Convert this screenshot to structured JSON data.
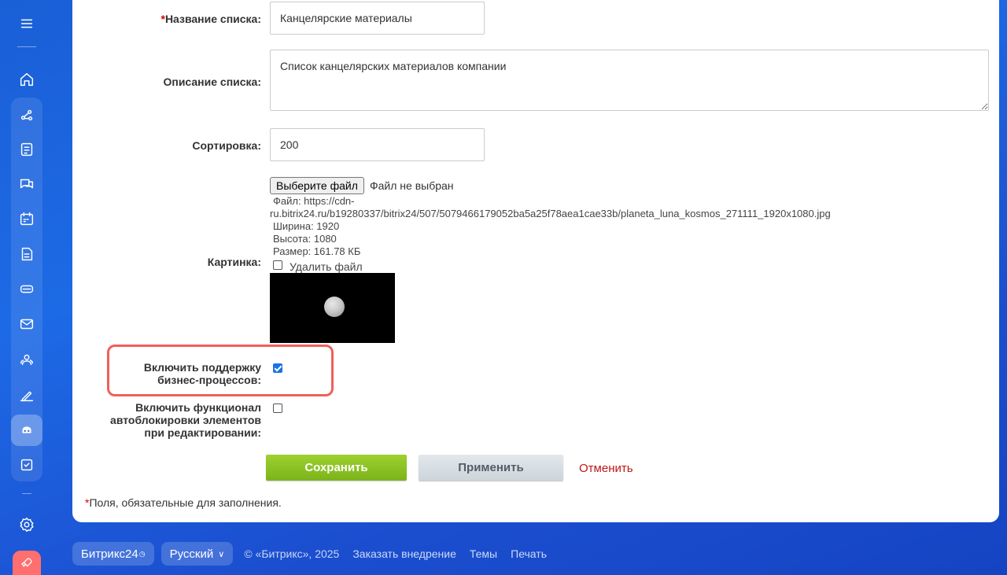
{
  "form": {
    "name_label_req": "*",
    "name_label": "Название списка:",
    "name_value": "Канцелярские материалы",
    "description_label": "Описание списка:",
    "description_value": "Список канцелярских материалов компании",
    "sort_label": "Сортировка:",
    "sort_value": "200",
    "picture_label": "Картинка:",
    "file_button": "Выберите файл",
    "file_none": "Файл не выбран",
    "file_line1": "Файл: https://cdn-",
    "file_line2": "ru.bitrix24.ru/b19280337/bitrix24/507/5079466179052ba5a25f78aea1cae33b/planeta_luna_kosmos_271111_1920x1080.jpg",
    "file_width": "Ширина: 1920",
    "file_height": "Высота: 1080",
    "file_size": "Размер: 161.78 КБ",
    "delete_file": "Удалить файл",
    "bp_label_1": "Включить поддержку",
    "bp_label_2": "бизнес-процессов:",
    "bp_checked": true,
    "lock_label_1": "Включить функционал",
    "lock_label_2": "автоблокировки элементов",
    "lock_label_3": "при редактировании:",
    "lock_checked": false,
    "save": "Сохранить",
    "apply": "Применить",
    "cancel": "Отменить",
    "required_note_star": "*",
    "required_note": "Поля, обязательные для заполнения."
  },
  "footer": {
    "brand": "Битрикс24",
    "language": "Русский",
    "copyright": "© «Битрикс», 2025",
    "links": [
      "Заказать внедрение",
      "Темы",
      "Печать"
    ]
  },
  "nav_icons": [
    "menu-icon",
    "home-icon",
    "feed-icon",
    "tasks-icon",
    "chat-icon",
    "calendar-icon",
    "document-icon",
    "drive-icon",
    "mail-icon",
    "contacts-icon",
    "sign-icon",
    "bot-icon",
    "checklist-icon",
    "settings-icon",
    "rocket-icon"
  ],
  "colors": {
    "save": "#8cc421",
    "cancel": "#c01515",
    "highlight": "#f0605a",
    "accent": "#1a73e8"
  }
}
